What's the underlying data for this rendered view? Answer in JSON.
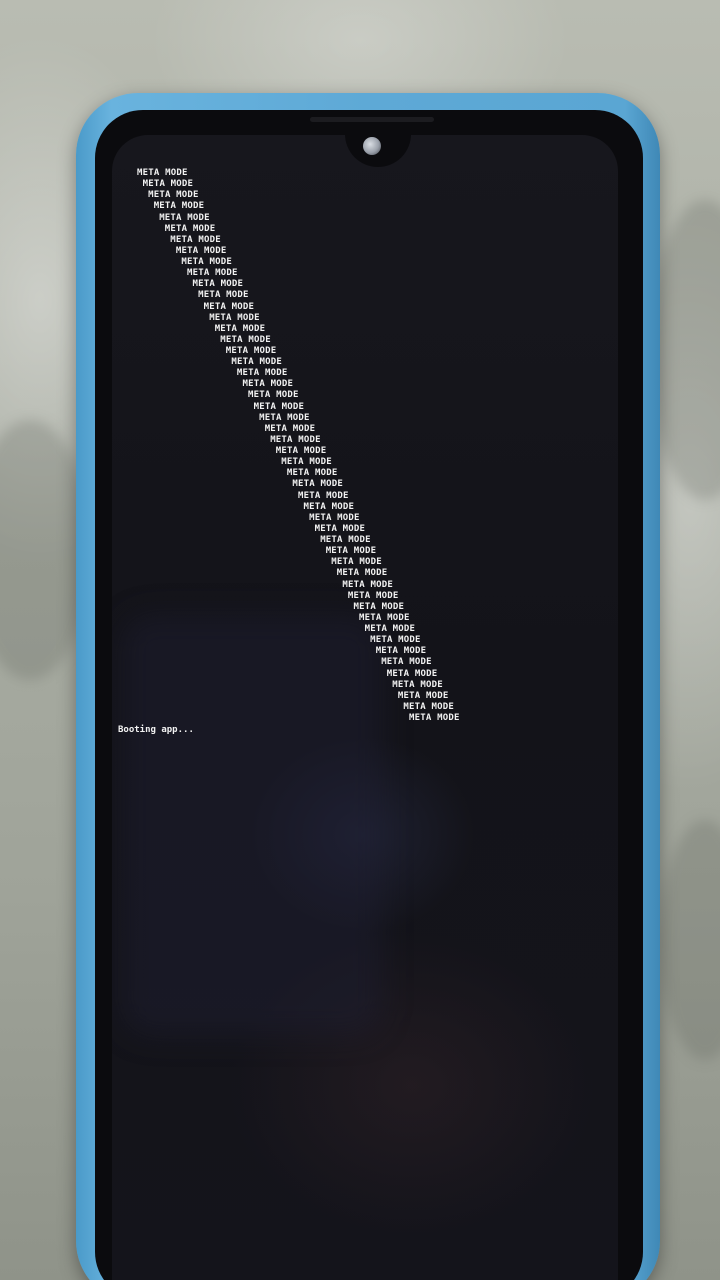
{
  "screen": {
    "repeat_line": "META MODE",
    "repeat_count": 50,
    "status_line": "Booting app..."
  },
  "colors": {
    "case": "#5aa6d3",
    "screen_background": "#14141b",
    "text": "#f2f2f2"
  }
}
